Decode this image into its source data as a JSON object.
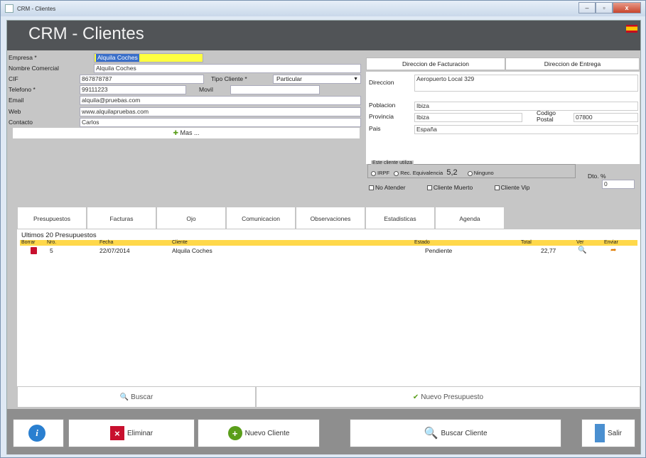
{
  "window": {
    "title": "CRM - Clientes",
    "controls": [
      "–",
      "▫",
      "x"
    ]
  },
  "header": {
    "title": "CRM - Clientes"
  },
  "form": {
    "empresa_label": "Empresa *",
    "empresa_value": "Alquila Coches",
    "nombre_label": "Nombre Comercial",
    "nombre_value": "Alquila Coches",
    "cif_label": "CIF",
    "cif_value": "867878787",
    "tipo_label": "Tipo Cliente *",
    "tipo_value": "Particular",
    "telefono_label": "Telefono *",
    "telefono_value": "99111223",
    "movil_label": "Movil",
    "movil_value": "",
    "email_label": "Email",
    "email_value": "alquila@pruebas.com",
    "web_label": "Web",
    "web_value": "www.alquilapruebas.com",
    "contacto_label": "Contacto",
    "contacto_value": "Carlos",
    "mas_label": "Mas ..."
  },
  "address": {
    "tab_facturacion": "Direccion de Facturacion",
    "tab_entrega": "Direccion de Entrega",
    "direccion_label": "Direccion",
    "direccion_value": "Aeropuerto Local 329",
    "poblacion_label": "Poblacion",
    "poblacion_value": "Ibiza",
    "provincia_label": "Provincia",
    "provincia_value": "Ibiza",
    "cp_label": "Codigo Postal",
    "cp_value": "07800",
    "pais_label": "Pais",
    "pais_value": "España",
    "group_label": "Este cliente utiliza",
    "opt_irpf": "IRPF",
    "opt_rec": "Rec. Equivalencia",
    "rec_value": "5,2",
    "opt_ninguno": "Ninguno",
    "dto_label": "Dto. %",
    "dto_value": "0",
    "chk_no_atender": "No Atender",
    "chk_muerto": "Cliente Muerto",
    "chk_vip": "Cliente Vip"
  },
  "tabs": [
    "Presupuestos",
    "Facturas",
    "Ojo",
    "Comunicacion",
    "Observaciones",
    "Estadisticas",
    "Agenda"
  ],
  "panel": {
    "title": "Ultimos 20 Presupuestos",
    "columns": [
      "Borrar",
      "Nro.",
      "Fecha",
      "Cliente",
      "Estado",
      "Total",
      "Ver",
      "Enviar"
    ],
    "rows": [
      {
        "nro": "5",
        "fecha": "22/07/2014",
        "cliente": "Alquila Coches",
        "estado": "Pendiente",
        "total": "22,77"
      }
    ],
    "buscar": "Buscar",
    "nuevo": "Nuevo Presupuesto"
  },
  "toolbar": {
    "info": "i",
    "eliminar": "Eliminar",
    "nuevo_cliente": "Nuevo Cliente",
    "buscar_cliente": "Buscar Cliente",
    "salir": "Salir"
  },
  "colors": {
    "header": "#515457",
    "highlight": "#ffff40",
    "table_header": "#ffd84a"
  }
}
